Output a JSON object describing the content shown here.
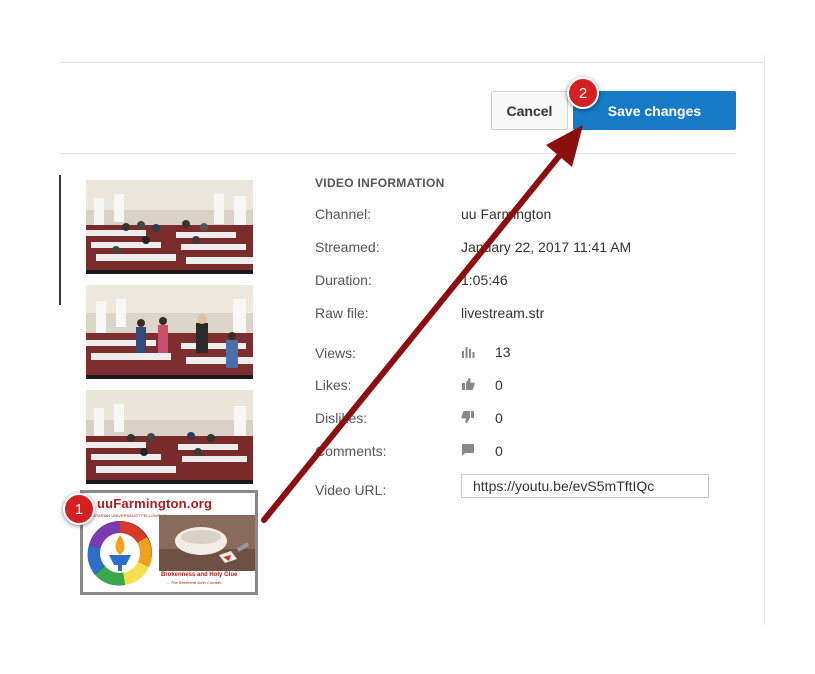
{
  "header": {
    "cancel_label": "Cancel",
    "save_label": "Save changes"
  },
  "thumbnail": {
    "selected": {
      "logo_text": "uuFarmington.org",
      "logo_subtext": "UNITARIAN UNIVERSALIST FELLOWSHIP",
      "caption_title": "Brokenness and Holy Glue",
      "caption_author": "-- The Reverend John Corrado"
    }
  },
  "video_info": {
    "section_title": "VIDEO INFORMATION",
    "channel_label": "Channel:",
    "channel_value": "uu Farmington",
    "streamed_label": "Streamed:",
    "streamed_value": "January 22, 2017 11:41 AM",
    "duration_label": "Duration:",
    "duration_value": "1:05:46",
    "rawfile_label": "Raw file:",
    "rawfile_value": "livestream.str",
    "views_label": "Views:",
    "views_value": "13",
    "likes_label": "Likes:",
    "likes_value": "0",
    "dislikes_label": "Dislikes:",
    "dislikes_value": "0",
    "comments_label": "Comments:",
    "comments_value": "0",
    "url_label": "Video URL:",
    "url_value": "https://youtu.be/evS5mTftIQc"
  },
  "annotations": {
    "step1": "1",
    "step2": "2",
    "arrow_color": "#8b0f0f",
    "badge_color": "#d42020"
  },
  "colors": {
    "primary_button": "#167ac6",
    "text_label": "#555555"
  }
}
